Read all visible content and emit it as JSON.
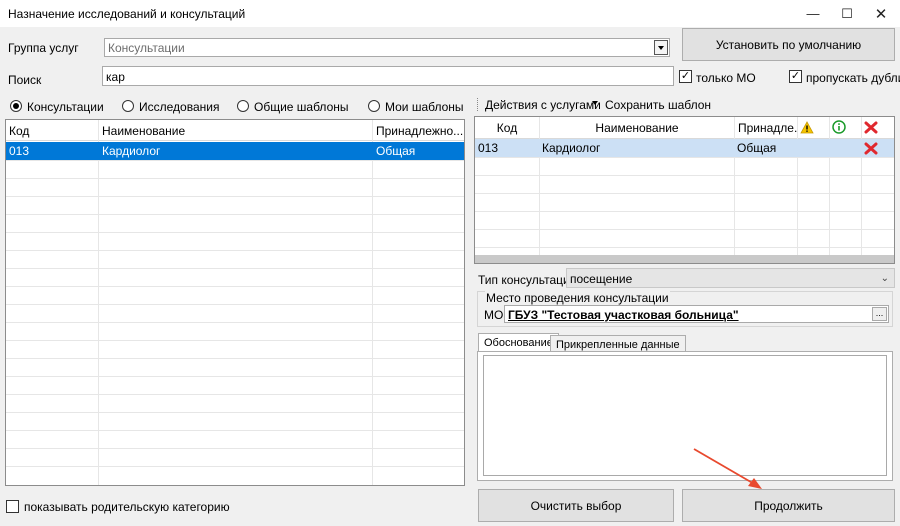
{
  "window": {
    "title": "Назначение исследований и консультаций"
  },
  "top": {
    "group_label": "Группа услуг",
    "group_value": "Консультации",
    "set_default_button": "Установить по умолчанию",
    "search_label": "Поиск",
    "search_value": "кар",
    "only_mo_label": "только МО",
    "only_mo_checked": true,
    "skip_duplicates_label": "пропускать дубли",
    "skip_duplicates_checked": true
  },
  "radios": [
    {
      "label": "Консультации",
      "selected": true
    },
    {
      "label": "Исследования",
      "selected": false
    },
    {
      "label": "Общие шаблоны",
      "selected": false
    },
    {
      "label": "Мои шаблоны",
      "selected": false
    }
  ],
  "left_grid": {
    "columns": [
      "Код",
      "Наименование",
      "Принадлежно..."
    ],
    "rows": [
      {
        "code": "013",
        "name": "Кардиолог",
        "owner": "Общая"
      }
    ]
  },
  "toolbar": {
    "actions_label": "Действия с услугами",
    "save_template_label": "Сохранить шаблон"
  },
  "right_grid": {
    "columns": [
      "Код",
      "Наименование",
      "Принадле..."
    ],
    "rows": [
      {
        "code": "013",
        "name": "Кардиолог",
        "owner": "Общая"
      }
    ]
  },
  "consultation": {
    "type_label": "Тип консультации",
    "type_value": "посещение",
    "place_label": "Место проведения консультации",
    "mo_label": "МО",
    "mo_value": "ГБУЗ \"Тестовая участковая больница\""
  },
  "tabs": {
    "justification": "Обоснование",
    "attached": "Прикрепленные данные"
  },
  "bottom": {
    "show_parent_label": "показывать родительскую категорию",
    "clear_button": "Очистить выбор",
    "continue_button": "Продолжить"
  },
  "colors": {
    "selection": "#0078d7",
    "selection_inactive": "#cce0f5",
    "arrow": "#e8492e"
  }
}
